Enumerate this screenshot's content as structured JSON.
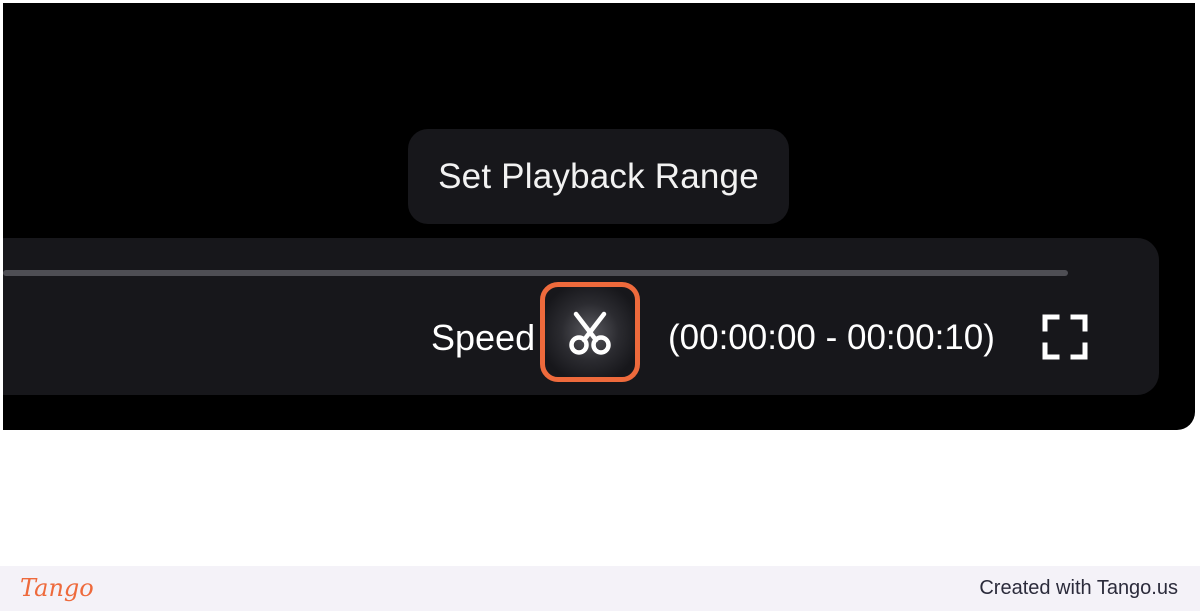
{
  "player": {
    "tooltip_text": "Set Playback Range",
    "speed_label": "Speed",
    "range_text": "(00:00:00 - 00:00:10)",
    "icons": {
      "range_button": "scissors-icon",
      "fullscreen_button": "fullscreen-icon"
    },
    "colors": {
      "player_bg": "#000000",
      "control_bar_bg": "#17171b",
      "highlight": "#ee6a3c"
    }
  },
  "footer": {
    "brand": "Tango",
    "created_with": "Created with Tango.us",
    "brand_color": "#ee6a3c"
  }
}
